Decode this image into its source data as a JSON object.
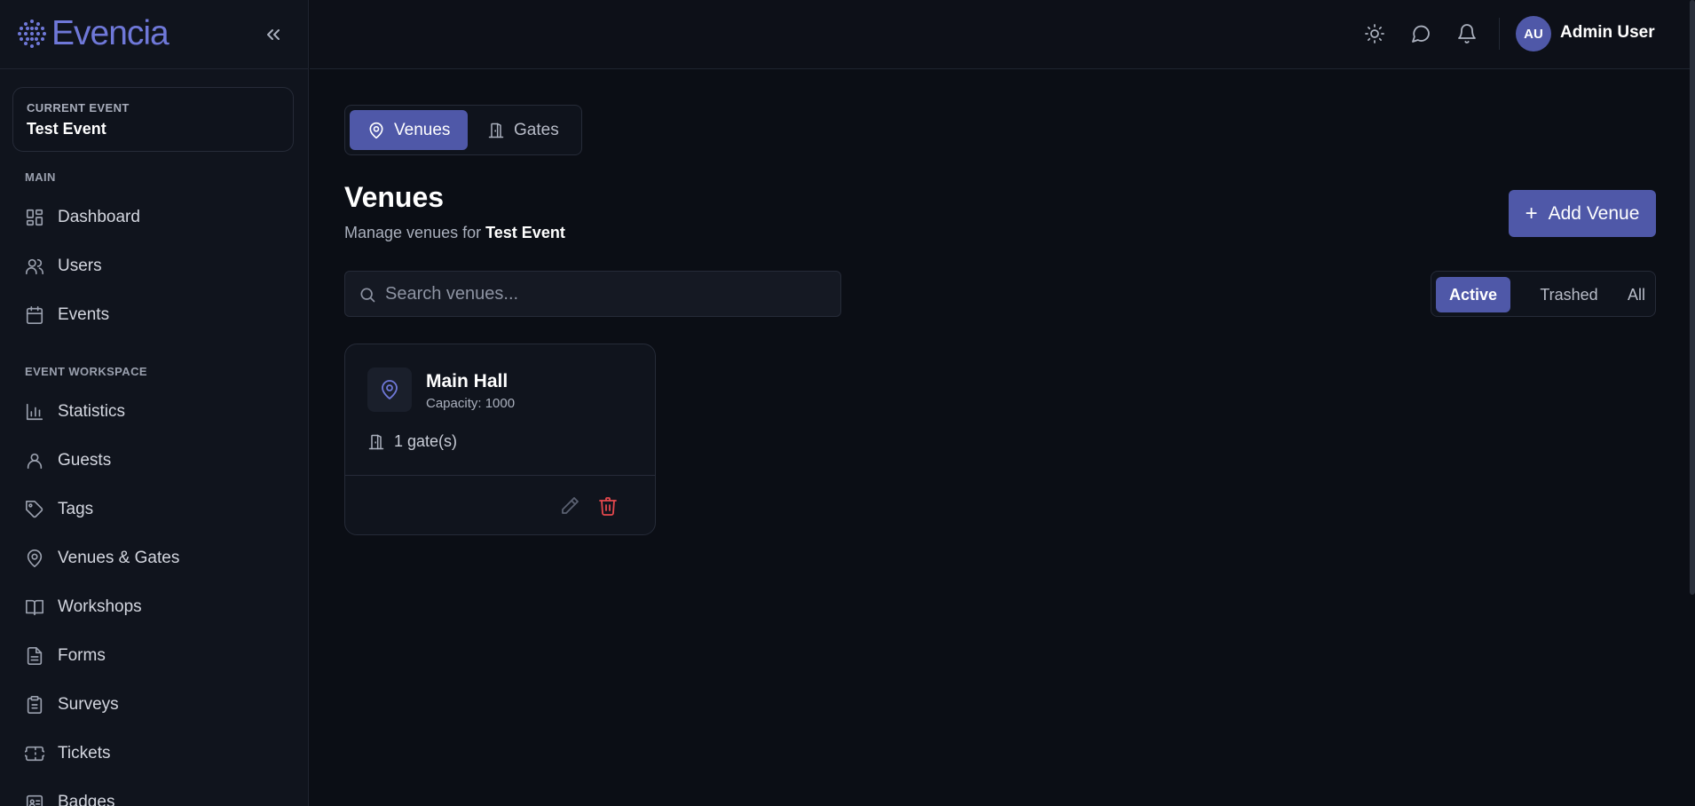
{
  "app": {
    "logo_text": "Evencia"
  },
  "sidebar": {
    "current_event_caption": "CURRENT EVENT",
    "current_event_name": "Test Event",
    "sections": {
      "main": "MAIN",
      "workspace": "EVENT WORKSPACE"
    },
    "items": [
      {
        "label": "Dashboard",
        "icon": "dashboard-icon"
      },
      {
        "label": "Users",
        "icon": "users-icon"
      },
      {
        "label": "Events",
        "icon": "calendar-icon"
      },
      {
        "label": "Statistics",
        "icon": "bar-chart-icon"
      },
      {
        "label": "Guests",
        "icon": "user-icon"
      },
      {
        "label": "Tags",
        "icon": "tag-icon"
      },
      {
        "label": "Venues & Gates",
        "icon": "map-pin-icon"
      },
      {
        "label": "Workshops",
        "icon": "book-icon"
      },
      {
        "label": "Forms",
        "icon": "file-icon"
      },
      {
        "label": "Surveys",
        "icon": "clipboard-icon"
      },
      {
        "label": "Tickets",
        "icon": "ticket-icon"
      },
      {
        "label": "Badges",
        "icon": "badge-icon"
      }
    ]
  },
  "header": {
    "avatar_initials": "AU",
    "user_name": "Admin User"
  },
  "tabs": [
    {
      "label": "Venues",
      "icon": "map-pin-icon",
      "active": true
    },
    {
      "label": "Gates",
      "icon": "door-icon",
      "active": false
    }
  ],
  "page": {
    "title": "Venues",
    "subtitle_prefix": "Manage venues for",
    "subtitle_event": "Test Event",
    "add_button": "Add Venue"
  },
  "search": {
    "placeholder": "Search venues...",
    "value": ""
  },
  "filters": {
    "active": "Active",
    "trashed": "Trashed",
    "all": "All",
    "selected": "Active"
  },
  "venues": [
    {
      "name": "Main Hall",
      "capacity": "Capacity: 1000",
      "gates": "1 gate(s)"
    }
  ],
  "colors": {
    "accent": "#4f58a8",
    "danger": "#e5484d",
    "background": "#0b0e15"
  }
}
